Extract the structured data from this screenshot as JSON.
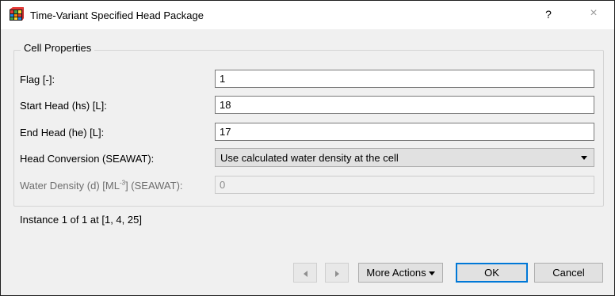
{
  "window": {
    "title": "Time-Variant Specified Head Package",
    "help_label": "?",
    "close_label": "×"
  },
  "group": {
    "title": "Cell Properties",
    "flag": {
      "label": "Flag [-]:",
      "value": "1"
    },
    "start_head": {
      "label": "Start Head (hs) [L]:",
      "value": "18"
    },
    "end_head": {
      "label": "End Head (he) [L]:",
      "value": "17"
    },
    "head_conversion": {
      "label": "Head Conversion (SEAWAT):",
      "value": "Use calculated water density at the cell"
    },
    "water_density": {
      "label_prefix": "Water Density (d) [ML",
      "label_sup": "-3",
      "label_suffix": "] (SEAWAT):",
      "value": "0"
    }
  },
  "instance_text": "Instance 1 of 1 at [1, 4, 25]",
  "buttons": {
    "more_actions": "More Actions",
    "ok": "OK",
    "cancel": "Cancel"
  },
  "colors": {
    "default_button_border": "#0078d7",
    "dialog_background": "#f0f0f0"
  }
}
